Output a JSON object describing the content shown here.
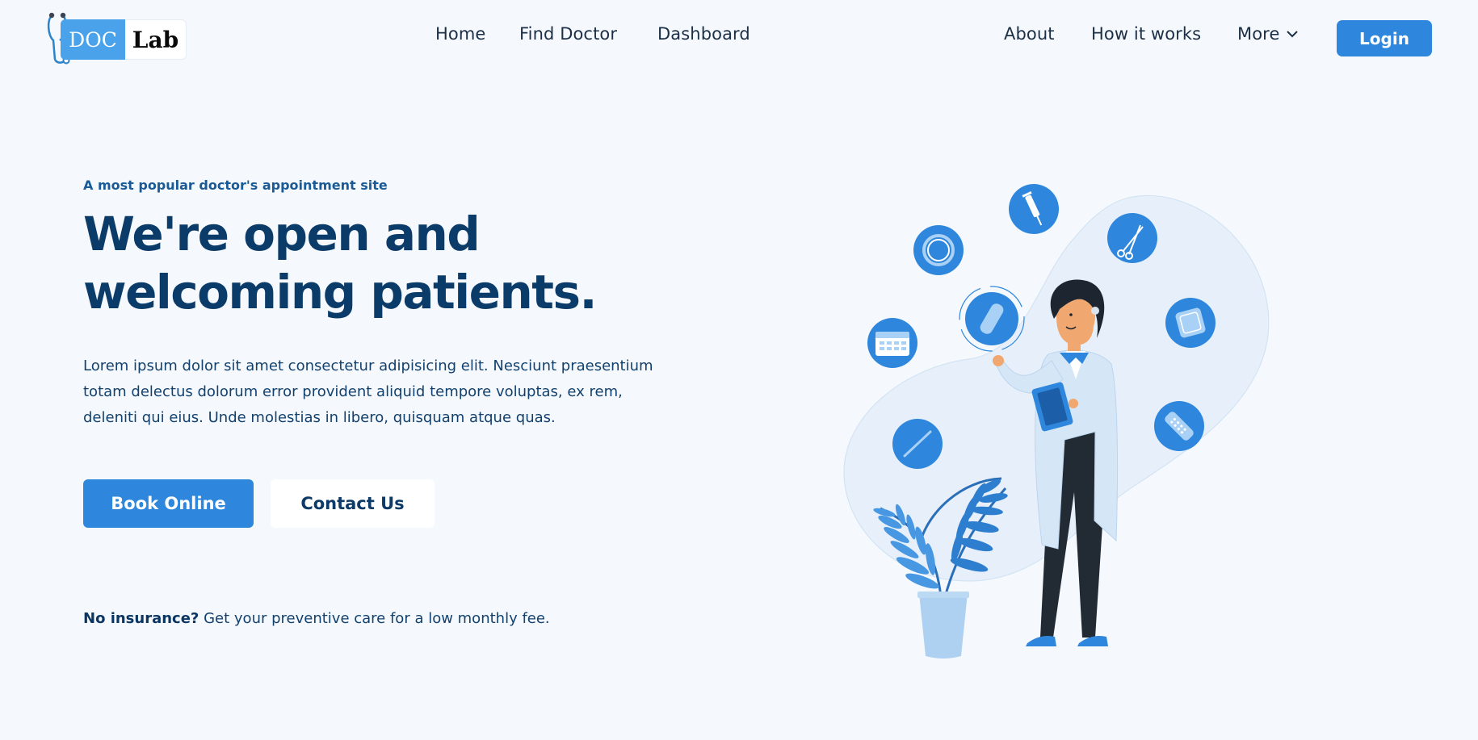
{
  "brand": {
    "logo_part1": "DOC",
    "logo_part2": "Lab"
  },
  "nav": {
    "home": "Home",
    "find_doctor": "Find Doctor",
    "dashboard": "Dashboard",
    "about": "About",
    "how_it_works": "How it works",
    "more": "More",
    "login": "Login"
  },
  "hero": {
    "tagline": "A most popular doctor's appointment site",
    "headline_line1": "We're open and",
    "headline_line2": "welcoming patients.",
    "description_line1": "Lorem ipsum dolor sit amet consectetur adipisicing elit. Nesciunt praesentium",
    "description_line2": "totam delectus dolorum error provident aliquid tempore voluptas, ex rem,",
    "description_line3": "deleniti qui eius. Unde molestias in libero, quisquam atque quas.",
    "book_button": "Book Online",
    "contact_button": "Contact Us",
    "insurance_bold": "No insurance?",
    "insurance_text": " Get your preventive care for a low monthly fee."
  },
  "colors": {
    "accent": "#2e87dc",
    "heading": "#0b3b69",
    "background": "#f5f9fe"
  },
  "icons": [
    "stethoscope-icon",
    "chevron-down-icon",
    "syringe-icon",
    "ring-icon",
    "scissors-icon",
    "pill-capsule-icon",
    "calendar-icon",
    "bandage-icon",
    "thermometer-icon",
    "pill-blister-icon"
  ]
}
